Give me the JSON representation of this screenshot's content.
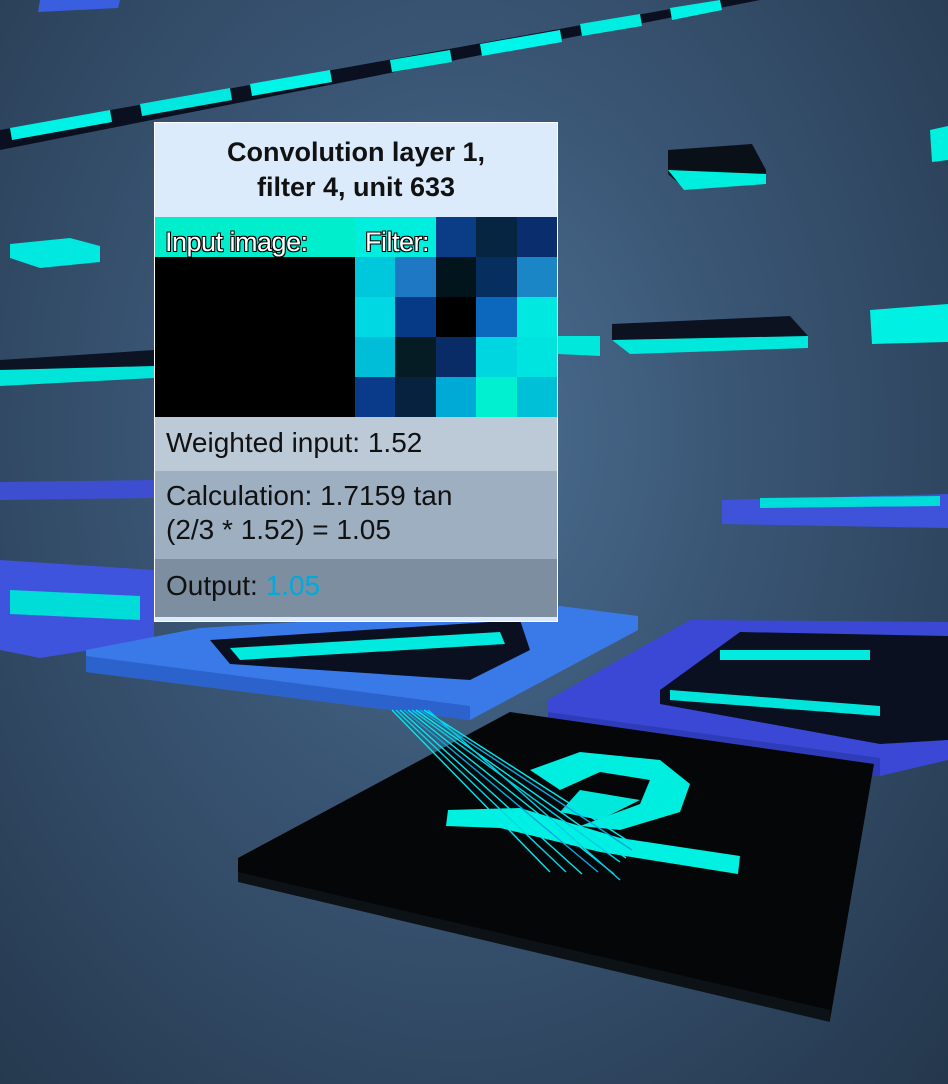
{
  "tooltip": {
    "title_line1": "Convolution layer 1,",
    "title_line2": "filter 4, unit 633",
    "input_image_label": "Input image:",
    "filter_label": "Filter:",
    "weighted_input": "Weighted input: 1.52",
    "calculation_line1": "Calculation: 1.7159 tan",
    "calculation_line2": "(2/3 * 1.52) = 1.05",
    "output_label": "Output:",
    "output_value": "1.05",
    "filter_colors": [
      "#00eedd",
      "#00eedd",
      "#0a3d86",
      "#062540",
      "#0a2d6e",
      "#00c8dc",
      "#1e78c4",
      "#02151c",
      "#062e5e",
      "#1a86c6",
      "#00d8e4",
      "#063a86",
      "#000000",
      "#0c68bc",
      "#00e8e0",
      "#00bed8",
      "#051c24",
      "#0a2c66",
      "#00d6e0",
      "#00e4e0",
      "#0a3a8a",
      "#07223e",
      "#00aad6",
      "#00f0d0",
      "#00c0d8"
    ]
  }
}
